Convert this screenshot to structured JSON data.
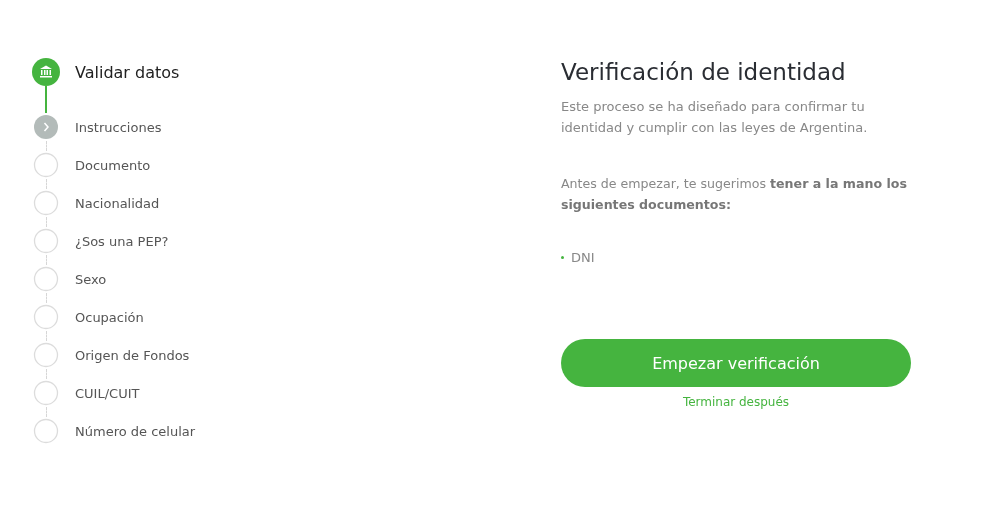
{
  "stepper": {
    "section": {
      "label": "Validar datos",
      "completed": true
    },
    "steps": [
      {
        "label": "Instrucciones",
        "selected": true
      },
      {
        "label": "Documento",
        "selected": false
      },
      {
        "label": "Nacionalidad",
        "selected": false
      },
      {
        "label": "¿Sos una PEP?",
        "selected": false
      },
      {
        "label": "Sexo",
        "selected": false
      },
      {
        "label": "Ocupación",
        "selected": false
      },
      {
        "label": "Origen de Fondos",
        "selected": false
      },
      {
        "label": "CUIL/CUIT",
        "selected": false
      },
      {
        "label": "Número de celular",
        "selected": false
      }
    ]
  },
  "panel": {
    "title": "Verificación de identidad",
    "intro": "Este proceso se ha diseñado para confirmar tu identidad y cumplir con las leyes de Argentina.",
    "advice": "Antes de empezar, te sugerimos **tener a la mano los siguientes documentos:**",
    "documents": [
      "DNI"
    ],
    "primary_button": "Empezar verificación",
    "secondary_link": "Terminar después"
  }
}
